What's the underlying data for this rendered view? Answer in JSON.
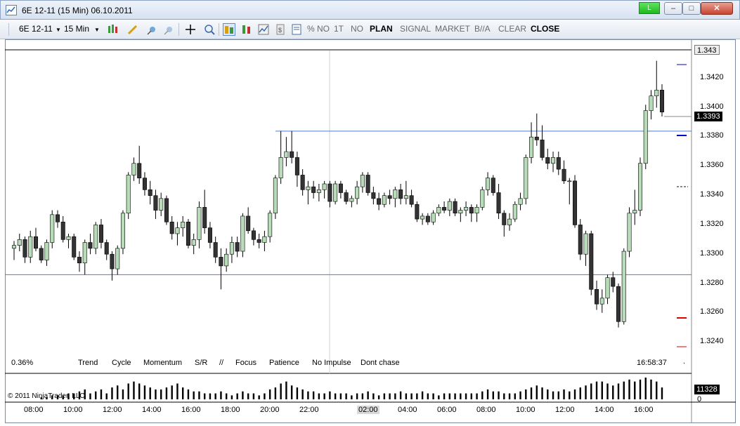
{
  "window": {
    "title": "6E 12-11 (15 Min)  06.10.2011",
    "live_label": "L"
  },
  "toolbar": {
    "instrument": "6E 12-11",
    "period": "15 Min",
    "items": [
      {
        "label": "% NO",
        "style": "dim"
      },
      {
        "label": "1T",
        "style": "dim"
      },
      {
        "label": "NO",
        "style": "dim"
      },
      {
        "label": "PLAN",
        "style": "bold"
      },
      {
        "label": "SIGNAL",
        "style": "dim"
      },
      {
        "label": "MARKET",
        "style": "dim"
      },
      {
        "label": "B//A",
        "style": "dim"
      },
      {
        "label": "CLEAR",
        "style": "dim"
      },
      {
        "label": "CLOSE",
        "style": "bold"
      }
    ]
  },
  "chart": {
    "percent_label": "0.36%",
    "clock": "16:58:37",
    "dot": ".",
    "copyright": "© 2011 NinjaTrader, LLC",
    "indicators": [
      "Trend",
      "Cycle",
      "Momentum",
      "S/R",
      "//",
      "Focus",
      "Patience",
      "No Impulse",
      "Dont chase"
    ],
    "price_axis": [
      "1.3420",
      "1.3400",
      "1.3380",
      "1.3360",
      "1.3340",
      "1.3320",
      "1.3300",
      "1.3280",
      "1.3260",
      "1.3240"
    ],
    "top_price": "1.343",
    "last_price": "1.3393",
    "volume_last": "11328",
    "volume_zero": "0",
    "time_axis": [
      "08:00",
      "10:00",
      "12:00",
      "14:00",
      "16:00",
      "18:00",
      "20:00",
      "22:00",
      "02:00",
      "04:00",
      "06:00",
      "08:00",
      "10:00",
      "12:00",
      "14:00",
      "16:00"
    ],
    "highlight_time": "02:00",
    "colors": {
      "up_candle": "#b8dcb8",
      "down_candle": "#333333",
      "hline": "#4a7fc0",
      "blue_mark": "#0000cc",
      "red_mark": "#e00000",
      "last_box": "#000000"
    }
  },
  "chart_data": {
    "type": "candlestick",
    "title": "",
    "ylim": [
      1.323,
      1.3435
    ],
    "levels": [
      1.338,
      1.3282
    ],
    "candles": [
      [
        1.33,
        1.3305,
        1.3292,
        1.3302
      ],
      [
        1.3302,
        1.331,
        1.3298,
        1.3306
      ],
      [
        1.3306,
        1.3308,
        1.329,
        1.3294
      ],
      [
        1.3294,
        1.3312,
        1.329,
        1.3308
      ],
      [
        1.3308,
        1.3314,
        1.3298,
        1.33
      ],
      [
        1.33,
        1.3302,
        1.329,
        1.3292
      ],
      [
        1.3292,
        1.3306,
        1.3288,
        1.3304
      ],
      [
        1.3304,
        1.3326,
        1.33,
        1.3323
      ],
      [
        1.3323,
        1.3326,
        1.3314,
        1.3318
      ],
      [
        1.3318,
        1.3322,
        1.3304,
        1.3306
      ],
      [
        1.3306,
        1.331,
        1.33,
        1.3308
      ],
      [
        1.3308,
        1.331,
        1.3292,
        1.3294
      ],
      [
        1.3294,
        1.3298,
        1.3284,
        1.329
      ],
      [
        1.329,
        1.3306,
        1.3282,
        1.3304
      ],
      [
        1.3304,
        1.331,
        1.3296,
        1.33
      ],
      [
        1.33,
        1.3318,
        1.3296,
        1.3316
      ],
      [
        1.3316,
        1.332,
        1.33,
        1.3304
      ],
      [
        1.3304,
        1.3306,
        1.3292,
        1.3296
      ],
      [
        1.3296,
        1.3298,
        1.3278,
        1.3286
      ],
      [
        1.3286,
        1.3302,
        1.3282,
        1.33
      ],
      [
        1.33,
        1.3326,
        1.3296,
        1.3324
      ],
      [
        1.3324,
        1.3352,
        1.332,
        1.335
      ],
      [
        1.335,
        1.3362,
        1.3346,
        1.3358
      ],
      [
        1.3358,
        1.337,
        1.3344,
        1.3348
      ],
      [
        1.3348,
        1.3352,
        1.3336,
        1.334
      ],
      [
        1.334,
        1.3346,
        1.333,
        1.3336
      ],
      [
        1.3336,
        1.334,
        1.332,
        1.3326
      ],
      [
        1.3326,
        1.3338,
        1.3322,
        1.3334
      ],
      [
        1.3334,
        1.3336,
        1.3316,
        1.3318
      ],
      [
        1.3318,
        1.3322,
        1.3306,
        1.331
      ],
      [
        1.331,
        1.3318,
        1.3302,
        1.3314
      ],
      [
        1.3314,
        1.3322,
        1.3308,
        1.3318
      ],
      [
        1.3318,
        1.332,
        1.33,
        1.3302
      ],
      [
        1.3302,
        1.331,
        1.3296,
        1.3306
      ],
      [
        1.3306,
        1.3332,
        1.33,
        1.3328
      ],
      [
        1.3328,
        1.334,
        1.331,
        1.3314
      ],
      [
        1.3314,
        1.3318,
        1.33,
        1.3304
      ],
      [
        1.3304,
        1.3308,
        1.329,
        1.3294
      ],
      [
        1.3294,
        1.33,
        1.3272,
        1.3288
      ],
      [
        1.3288,
        1.33,
        1.3284,
        1.3296
      ],
      [
        1.3296,
        1.3308,
        1.329,
        1.3304
      ],
      [
        1.3304,
        1.3308,
        1.3294,
        1.3298
      ],
      [
        1.3298,
        1.3324,
        1.3294,
        1.3322
      ],
      [
        1.3322,
        1.3328,
        1.331,
        1.3312
      ],
      [
        1.3312,
        1.3314,
        1.3302,
        1.3306
      ],
      [
        1.3306,
        1.331,
        1.33,
        1.3304
      ],
      [
        1.3304,
        1.3312,
        1.3298,
        1.3308
      ],
      [
        1.3308,
        1.3326,
        1.3304,
        1.3324
      ],
      [
        1.3324,
        1.335,
        1.332,
        1.3348
      ],
      [
        1.3348,
        1.338,
        1.3344,
        1.3362
      ],
      [
        1.3362,
        1.3376,
        1.3356,
        1.3366
      ],
      [
        1.3366,
        1.338,
        1.3358,
        1.3362
      ],
      [
        1.3362,
        1.3366,
        1.3342,
        1.335
      ],
      [
        1.335,
        1.3354,
        1.3336,
        1.334
      ],
      [
        1.334,
        1.3346,
        1.333,
        1.3342
      ],
      [
        1.3342,
        1.3346,
        1.3334,
        1.3338
      ],
      [
        1.3338,
        1.3344,
        1.3332,
        1.334
      ],
      [
        1.334,
        1.3346,
        1.3334,
        1.3344
      ],
      [
        1.3344,
        1.3346,
        1.3328,
        1.3332
      ],
      [
        1.3332,
        1.3346,
        1.333,
        1.3344
      ],
      [
        1.3344,
        1.3346,
        1.3334,
        1.3338
      ],
      [
        1.3338,
        1.334,
        1.333,
        1.3332
      ],
      [
        1.3332,
        1.3336,
        1.3328,
        1.3334
      ],
      [
        1.3334,
        1.3346,
        1.333,
        1.3342
      ],
      [
        1.3342,
        1.3352,
        1.3338,
        1.335
      ],
      [
        1.335,
        1.3352,
        1.3336,
        1.3338
      ],
      [
        1.3338,
        1.3342,
        1.333,
        1.3334
      ],
      [
        1.3334,
        1.3338,
        1.3326,
        1.333
      ],
      [
        1.333,
        1.3338,
        1.3328,
        1.3336
      ],
      [
        1.3336,
        1.334,
        1.333,
        1.3334
      ],
      [
        1.3334,
        1.3342,
        1.3328,
        1.334
      ],
      [
        1.334,
        1.3344,
        1.333,
        1.3334
      ],
      [
        1.3334,
        1.3346,
        1.333,
        1.3336
      ],
      [
        1.3336,
        1.334,
        1.3328,
        1.333
      ],
      [
        1.333,
        1.3332,
        1.3318,
        1.332
      ],
      [
        1.332,
        1.3324,
        1.3316,
        1.3322
      ],
      [
        1.3322,
        1.3324,
        1.3316,
        1.3318
      ],
      [
        1.3318,
        1.3326,
        1.3316,
        1.3324
      ],
      [
        1.3324,
        1.333,
        1.3322,
        1.3328
      ],
      [
        1.3328,
        1.3332,
        1.3324,
        1.3326
      ],
      [
        1.3326,
        1.3334,
        1.3322,
        1.3332
      ],
      [
        1.3332,
        1.3334,
        1.3322,
        1.3324
      ],
      [
        1.3324,
        1.3328,
        1.3318,
        1.3326
      ],
      [
        1.3326,
        1.3332,
        1.3322,
        1.3328
      ],
      [
        1.3328,
        1.333,
        1.3318,
        1.3324
      ],
      [
        1.3324,
        1.333,
        1.3318,
        1.3328
      ],
      [
        1.3328,
        1.3342,
        1.3326,
        1.334
      ],
      [
        1.334,
        1.3352,
        1.3336,
        1.3348
      ],
      [
        1.3348,
        1.335,
        1.3336,
        1.3338
      ],
      [
        1.3338,
        1.3344,
        1.332,
        1.3324
      ],
      [
        1.3324,
        1.3326,
        1.3308,
        1.3316
      ],
      [
        1.3316,
        1.3324,
        1.3312,
        1.332
      ],
      [
        1.332,
        1.3332,
        1.3318,
        1.333
      ],
      [
        1.333,
        1.3338,
        1.3326,
        1.3334
      ],
      [
        1.3334,
        1.3364,
        1.333,
        1.3362
      ],
      [
        1.3362,
        1.3386,
        1.3358,
        1.3376
      ],
      [
        1.3376,
        1.3392,
        1.337,
        1.3374
      ],
      [
        1.3374,
        1.3384,
        1.336,
        1.3362
      ],
      [
        1.3362,
        1.3368,
        1.3354,
        1.3358
      ],
      [
        1.3358,
        1.3366,
        1.3352,
        1.3362
      ],
      [
        1.3362,
        1.3366,
        1.335,
        1.3354
      ],
      [
        1.3354,
        1.336,
        1.3344,
        1.3346
      ],
      [
        1.3346,
        1.3348,
        1.333,
        1.3346
      ],
      [
        1.3346,
        1.335,
        1.3314,
        1.3316
      ],
      [
        1.3316,
        1.332,
        1.3292,
        1.3296
      ],
      [
        1.3296,
        1.3312,
        1.3288,
        1.331
      ],
      [
        1.331,
        1.3312,
        1.3268,
        1.3272
      ],
      [
        1.3272,
        1.3278,
        1.3258,
        1.3262
      ],
      [
        1.3262,
        1.3272,
        1.3256,
        1.3266
      ],
      [
        1.3266,
        1.3282,
        1.3262,
        1.328
      ],
      [
        1.328,
        1.3284,
        1.327,
        1.3274
      ],
      [
        1.3274,
        1.3276,
        1.3246,
        1.325
      ],
      [
        1.325,
        1.33,
        1.3248,
        1.3298
      ],
      [
        1.3298,
        1.3328,
        1.3294,
        1.3324
      ],
      [
        1.3324,
        1.334,
        1.3316,
        1.3326
      ],
      [
        1.3326,
        1.3362,
        1.3322,
        1.3358
      ],
      [
        1.3358,
        1.3398,
        1.3354,
        1.3394
      ],
      [
        1.3394,
        1.3408,
        1.3388,
        1.3404
      ],
      [
        1.3404,
        1.3428,
        1.3396,
        1.3408
      ],
      [
        1.3408,
        1.3412,
        1.339,
        1.3393
      ]
    ],
    "volume": [
      0,
      0,
      0,
      0,
      0,
      1,
      1,
      2,
      2,
      2,
      3,
      3,
      4,
      5,
      3,
      4,
      5,
      3,
      6,
      7,
      5,
      8,
      9,
      8,
      7,
      6,
      5,
      5,
      6,
      7,
      8,
      6,
      5,
      4,
      4,
      3,
      3,
      3,
      4,
      3,
      2,
      3,
      4,
      3,
      3,
      2,
      3,
      5,
      6,
      8,
      9,
      7,
      6,
      5,
      4,
      4,
      3,
      3,
      4,
      3,
      3,
      3,
      2,
      3,
      3,
      4,
      3,
      2,
      3,
      3,
      3,
      4,
      3,
      3,
      3,
      4,
      3,
      3,
      2,
      3,
      3,
      3,
      3,
      3,
      3,
      3,
      4,
      5,
      4,
      4,
      3,
      3,
      3,
      4,
      5,
      6,
      7,
      6,
      5,
      4,
      4,
      5,
      4,
      5,
      6,
      7,
      8,
      9,
      9,
      8,
      7,
      8,
      9,
      10,
      9,
      10,
      11,
      10,
      9,
      6
    ]
  }
}
